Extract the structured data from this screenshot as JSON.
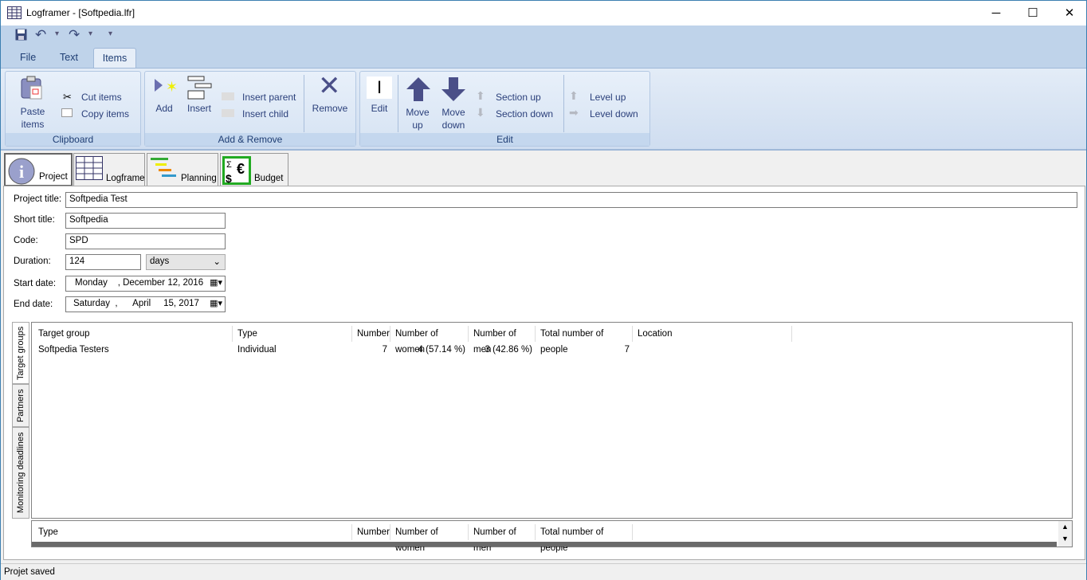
{
  "window": {
    "title": "Logframer - [Softpedia.lfr]",
    "minimize": "─",
    "maximize": "☐",
    "close": "✕"
  },
  "qat": {
    "save": "save-icon",
    "undo": "↶",
    "redo": "↷",
    "dropdown": "▾",
    "customize": "⩡"
  },
  "ribbon_tabs": [
    "File",
    "Text",
    "Items"
  ],
  "ribbon": {
    "clipboard": {
      "label": "Clipboard",
      "paste": "Paste",
      "paste2": "items",
      "cut": "Cut items",
      "copy": "Copy items"
    },
    "add_remove": {
      "label": "Add & Remove",
      "add": "Add",
      "insert": "Insert",
      "insert_parent": "Insert parent",
      "insert_child": "Insert child",
      "remove": "Remove"
    },
    "edit": {
      "label": "Edit",
      "edit": "Edit",
      "move_up": [
        "Move",
        "up"
      ],
      "move_down": [
        "Move",
        "down"
      ],
      "section_up": "Section up",
      "section_down": "Section down",
      "level_up": "Level up",
      "level_down": "Level down"
    }
  },
  "page_tabs": [
    "Project",
    "Logframe",
    "Planning",
    "Budget"
  ],
  "form": {
    "project_title_label": "Project title:",
    "project_title": "Softpedia Test",
    "short_title_label": "Short title:",
    "short_title": "Softpedia",
    "code_label": "Code:",
    "code": "SPD",
    "duration_label": "Duration:",
    "duration": "124",
    "duration_unit": "days",
    "start_date_label": "Start date:",
    "start_date": "Monday    , December 12, 2016",
    "end_date_label": "End date:",
    "end_date": "Saturday  ,      April     15, 2017"
  },
  "side_tabs": [
    "Target groups",
    "Partners",
    "Monitoring deadlines"
  ],
  "target_groups": {
    "columns": [
      "Target group",
      "Type",
      "Number",
      "Number of women",
      "Number of men",
      "Total number of people",
      "Location"
    ],
    "rows": [
      [
        "Softpedia Testers",
        "Individual",
        "7",
        "4 (57.14 %)",
        "3 (42.86 %)",
        "7",
        ""
      ]
    ]
  },
  "summary": {
    "columns": [
      "Type",
      "Number",
      "Number of women",
      "Number of men",
      "Total number of people"
    ]
  },
  "status": "Projet saved",
  "colors": {
    "ribbon": "#bfd3ea",
    "accent": "#2a3f7a"
  }
}
